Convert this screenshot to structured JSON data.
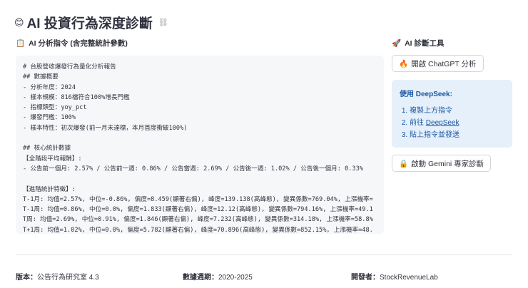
{
  "header": {
    "icon": "😊",
    "title": "AI 投資行為深度診斷",
    "link_icon": "⛓"
  },
  "prompt_section": {
    "icon": "📋",
    "title": "AI 分析指令 (含完整統計參數)"
  },
  "code_lines": [
    "# 台股營收爆發行為量化分析報告",
    "## 數據概要",
    "- 分析年度：2024",
    "- 樣本規模：816檔符合100%增長門檻",
    "- 指標類型：yoy_pct",
    "- 爆發門檻：100%",
    "- 樣本特性：初次爆發(前一月未達標，本月首度衝破100%)",
    "",
    "## 核心統計數據",
    "【全階段平均報酬】:",
    "- 公告前一個月: 2.57% / 公告前一週: 0.86% / 公告當週: 2.69% / 公告後一週: 1.02% / 公告後一個月: 0.33%",
    "",
    "【進階統計特徵】:",
    "T-1月: 均值=2.57%, 中位=-0.86%, 偏度=8.459(顯著右偏), 峰度=139.138(高峰態), 變異係數=769.04%, 上漲機率=",
    "T-1周: 均值=0.86%, 中位=0.0%, 偏度=1.833(顯著右偏), 峰度=12.12(高峰態), 變異係數=794.16%, 上漲機率=49.1",
    "T周: 均值=2.69%, 中位=0.91%, 偏度=1.846(顯著右偏), 峰度=7.232(高峰態), 變異係數=314.18%, 上漲機率=58.8%",
    "T+1周: 均值=1.02%, 中位=0.0%, 偏度=5.782(顯著右偏), 峰度=70.896(高峰態), 變異係數=852.15%, 上漲機率=48."
  ],
  "tools": {
    "icon": "🚀",
    "title": "AI 診斷工具",
    "chatgpt": {
      "icon": "🔥",
      "label": "開啟 ChatGPT 分析"
    },
    "deepseek": {
      "heading": "使用 DeepSeek:",
      "steps": [
        "複製上方指令",
        "前往 ",
        "貼上指令並發送"
      ],
      "link": "DeepSeek"
    },
    "gemini": {
      "icon": "🔒",
      "label": "啟動 Gemini 專家診斷"
    }
  },
  "footer": {
    "version_label": "版本：",
    "version": "公告行為研究室 4.3",
    "period_label": "數據週期：",
    "period": "2020-2025",
    "dev_label": "開發者：",
    "dev": "StockRevenueLab"
  }
}
